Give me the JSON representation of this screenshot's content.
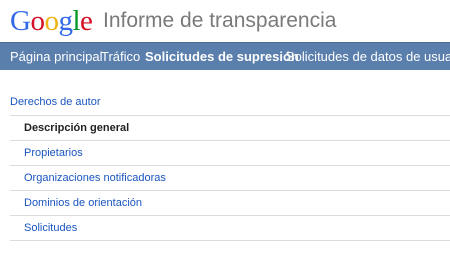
{
  "header": {
    "logo": {
      "letters": [
        "G",
        "o",
        "o",
        "g",
        "l",
        "e"
      ],
      "colors": [
        "#3369e8",
        "#d50f25",
        "#eeb211",
        "#3369e8",
        "#009925",
        "#d50f25"
      ]
    },
    "product_title": "Informe de transparencia"
  },
  "nav": {
    "background_color": "#5b7fad",
    "items": [
      {
        "label": "Página principal",
        "active": false
      },
      {
        "label": "Tráfico",
        "active": false
      },
      {
        "label": "Solicitudes de supresión",
        "active": true
      },
      {
        "label": "Solicitudes de datos de usuario",
        "active": false
      }
    ]
  },
  "breadcrumb": {
    "label": "Derechos de autor"
  },
  "menu": {
    "items": [
      {
        "label": "Descripción general",
        "current": true
      },
      {
        "label": "Propietarios",
        "current": false
      },
      {
        "label": "Organizaciones notificadoras",
        "current": false
      },
      {
        "label": "Dominios de orientación",
        "current": false
      },
      {
        "label": "Solicitudes",
        "current": false
      }
    ]
  },
  "colors": {
    "link": "#1a55c0",
    "divider": "#dcdcdc"
  }
}
